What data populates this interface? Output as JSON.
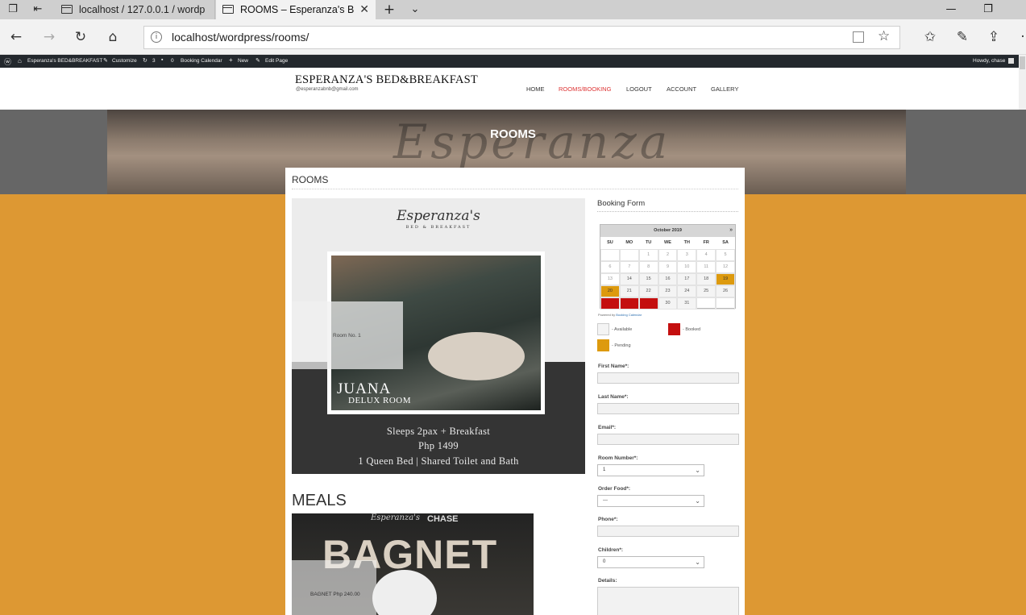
{
  "browser": {
    "tabs": [
      {
        "title": "localhost / 127.0.0.1 / wordp"
      },
      {
        "title": "ROOMS – Esperanza's B"
      }
    ],
    "url": "localhost/wordpress/rooms/"
  },
  "admin_bar": {
    "site": "Esperanza's BED&BREAKFAST",
    "customize": "Customize",
    "updates": "3",
    "comments": "0",
    "booking": "Booking Calendar",
    "new": "New",
    "edit": "Edit Page",
    "greeting": "Howdy, chase"
  },
  "site": {
    "brand": "ESPERANZA'S BED&BREAKFAST",
    "email": "@esperanzabnb@gmail.com",
    "nav": [
      "HOME",
      "ROOMS/BOOKING",
      "LOGOUT",
      "ACCOUNT",
      "GALLERY"
    ],
    "active_nav": "ROOMS/BOOKING",
    "accent": "#dd9833"
  },
  "banner": {
    "script": "Esperanza",
    "title": "ROOMS"
  },
  "content": {
    "title": "ROOMS"
  },
  "room": {
    "logo": "Esperanza's",
    "logo_sub": "BED & BREAKFAST",
    "label": "Room No. 1",
    "name": "JUANA",
    "type": "DELUX ROOM",
    "info": [
      "Sleeps 2pax + Breakfast",
      "Php 1499",
      "1 Queen Bed | Shared Toilet and Bath"
    ]
  },
  "meals": {
    "heading": "MEALS",
    "poster_logo": "Esperanza's",
    "poster_brand": "CHASE",
    "poster_title": "BAGNET",
    "item": "BAGNET  Php 240.00"
  },
  "booking": {
    "title": "Booking Form",
    "calendar": {
      "month": "October 2019",
      "next": "»",
      "weekdays": [
        "SU",
        "MO",
        "TU",
        "WE",
        "TH",
        "FR",
        "SA"
      ],
      "weeks": [
        [
          "",
          "",
          "1",
          "2",
          "3",
          "4",
          "5"
        ],
        [
          "6",
          "7",
          "8",
          "9",
          "10",
          "11",
          "12"
        ],
        [
          "13",
          "14",
          "15",
          "16",
          "17",
          "18",
          "19"
        ],
        [
          "20",
          "21",
          "22",
          "23",
          "24",
          "25",
          "26"
        ],
        [
          "27",
          "28",
          "29",
          "30",
          "31",
          "",
          ""
        ]
      ],
      "pending": [
        "19",
        "20"
      ],
      "booked": [
        "27",
        "28",
        "29"
      ],
      "past": [
        "1",
        "2",
        "3",
        "4",
        "5",
        "6",
        "7",
        "8",
        "9",
        "10",
        "11",
        "12",
        "13"
      ]
    },
    "powered": "Powered by",
    "powered_link": "Booking Calendar",
    "legend": {
      "available": "- Available",
      "booked": "- Booked",
      "pending": "- Pending"
    },
    "fields": {
      "first_name": "First Name*:",
      "last_name": "Last Name*:",
      "email": "Email*:",
      "room_number": "Room Number*:",
      "room_number_value": "1",
      "order_food": "Order Food*:",
      "order_food_value": "---",
      "phone": "Phone*:",
      "children": "Children*:",
      "children_value": "0",
      "details": "Details:"
    }
  }
}
